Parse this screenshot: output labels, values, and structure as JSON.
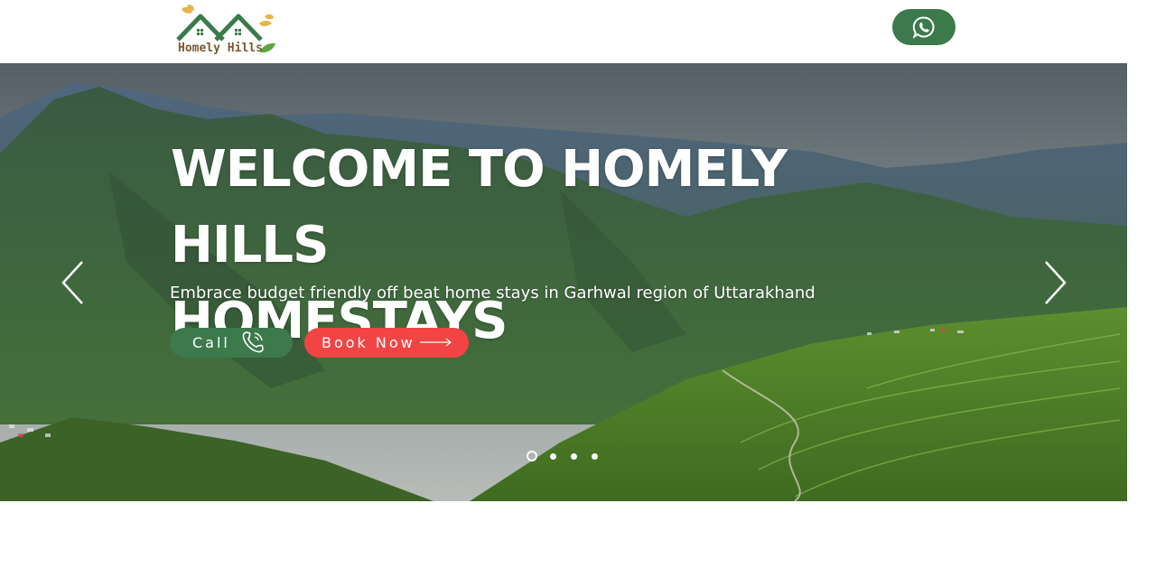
{
  "header": {
    "logo_text": "Homely Hills",
    "whatsapp_icon": "whatsapp-icon"
  },
  "hero": {
    "title_line1": "WELCOME TO HOMELY HILLS",
    "title_line2": "HOMESTAYS",
    "subtitle": "Embrace budget friendly off beat home stays in Garhwal region of Uttarakhand",
    "call_label": "Call",
    "book_label": "Book Now",
    "slides_count": 4,
    "active_slide": 1
  },
  "colors": {
    "brand_green": "#3c7a4c",
    "book_red": "#f24444",
    "logo_brown": "#7a5a2f"
  }
}
